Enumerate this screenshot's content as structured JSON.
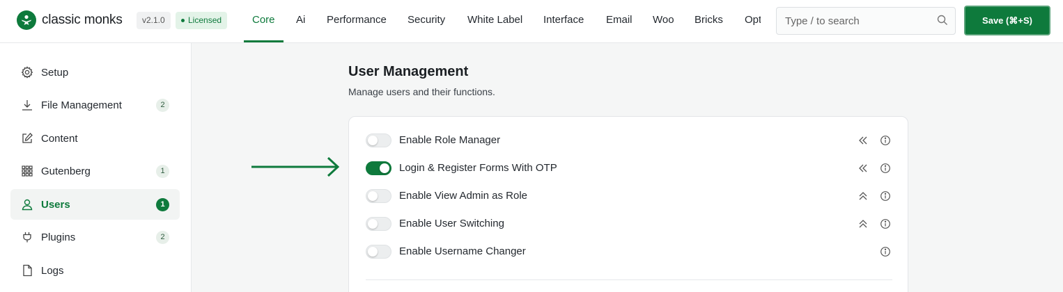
{
  "brand": {
    "name": "classic monks",
    "version": "v2.1.0",
    "license": "Licensed"
  },
  "colors": {
    "accent": "#0e7a3c"
  },
  "nav": [
    {
      "label": "Core",
      "active": true
    },
    {
      "label": "Ai"
    },
    {
      "label": "Performance"
    },
    {
      "label": "Security"
    },
    {
      "label": "White Label"
    },
    {
      "label": "Interface"
    },
    {
      "label": "Email"
    },
    {
      "label": "Woo"
    },
    {
      "label": "Bricks"
    },
    {
      "label": "Opt"
    }
  ],
  "search": {
    "placeholder": "Type / to search",
    "icon": "search-icon"
  },
  "save_label": "Save (⌘+S)",
  "sidebar": {
    "items": [
      {
        "label": "Setup",
        "icon": "gear-icon"
      },
      {
        "label": "File Management",
        "icon": "download-icon",
        "badge": "2"
      },
      {
        "label": "Content",
        "icon": "edit-icon"
      },
      {
        "label": "Gutenberg",
        "icon": "grid-icon",
        "badge": "1"
      },
      {
        "label": "Users",
        "icon": "user-icon",
        "badge": "1",
        "active": true
      },
      {
        "label": "Plugins",
        "icon": "plug-icon",
        "badge": "2"
      },
      {
        "label": "Logs",
        "icon": "file-icon"
      }
    ]
  },
  "section": {
    "title": "User Management",
    "subtitle": "Manage users and their functions."
  },
  "settings": [
    {
      "label": "Enable Role Manager",
      "enabled": false,
      "chevron": "chevrons-left-icon"
    },
    {
      "label": "Login & Register Forms With OTP",
      "enabled": true,
      "chevron": "chevrons-left-icon"
    },
    {
      "label": "Enable View Admin as Role",
      "enabled": false,
      "chevron": "chevrons-up-icon"
    },
    {
      "label": "Enable User Switching",
      "enabled": false,
      "chevron": "chevrons-up-icon"
    },
    {
      "label": "Enable Username Changer",
      "enabled": false,
      "chevron": ""
    }
  ]
}
